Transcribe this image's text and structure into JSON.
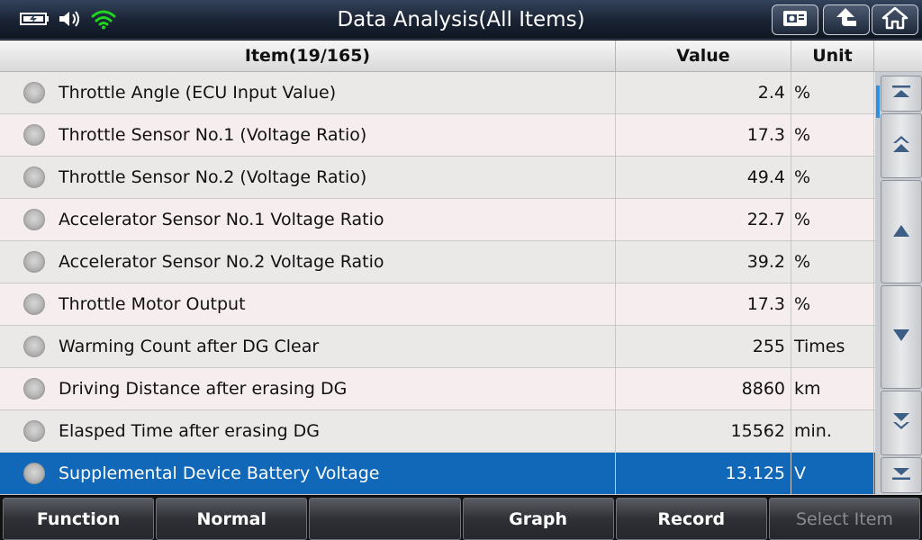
{
  "header": {
    "title": "Data Analysis(All Items)",
    "icons": [
      "battery-icon",
      "speaker-icon",
      "wifi-icon",
      "screenshot-icon",
      "back-icon",
      "home-icon"
    ]
  },
  "table": {
    "columns": {
      "item": "Item(19/165)",
      "value": "Value",
      "unit": "Unit"
    },
    "rows": [
      {
        "name": "Throttle Angle (ECU Input Value)",
        "value": "2.4",
        "unit": "%"
      },
      {
        "name": "Throttle Sensor No.1 (Voltage Ratio)",
        "value": "17.3",
        "unit": "%"
      },
      {
        "name": "Throttle Sensor No.2 (Voltage Ratio)",
        "value": "49.4",
        "unit": "%"
      },
      {
        "name": "Accelerator Sensor No.1 Voltage Ratio",
        "value": "22.7",
        "unit": "%"
      },
      {
        "name": "Accelerator Sensor No.2 Voltage Ratio",
        "value": "39.2",
        "unit": "%"
      },
      {
        "name": "Throttle Motor Output",
        "value": "17.3",
        "unit": "%"
      },
      {
        "name": "Warming Count after DG Clear",
        "value": "255",
        "unit": "Times"
      },
      {
        "name": "Driving Distance after erasing DG",
        "value": "8860",
        "unit": "km"
      },
      {
        "name": "Elasped Time after erasing DG",
        "value": "15562",
        "unit": "min."
      },
      {
        "name": "Supplemental Device Battery Voltage",
        "value": "13.125",
        "unit": "V"
      }
    ],
    "selected_index": 9
  },
  "scroll": {
    "buttons": [
      "scroll-top-icon",
      "page-up-icon",
      "up-icon",
      "down-icon",
      "page-down-icon",
      "scroll-bottom-icon"
    ]
  },
  "footer": {
    "buttons": [
      {
        "label": "Function",
        "enabled": true
      },
      {
        "label": "Normal",
        "enabled": true
      },
      {
        "label": "",
        "enabled": true
      },
      {
        "label": "Graph",
        "enabled": true
      },
      {
        "label": "Record",
        "enabled": true
      },
      {
        "label": "Select Item",
        "enabled": false
      }
    ]
  },
  "colors": {
    "selected_row": "#1168b8",
    "wifi": "#1fd61f",
    "scroll_indicator": "#2f8fe0"
  }
}
